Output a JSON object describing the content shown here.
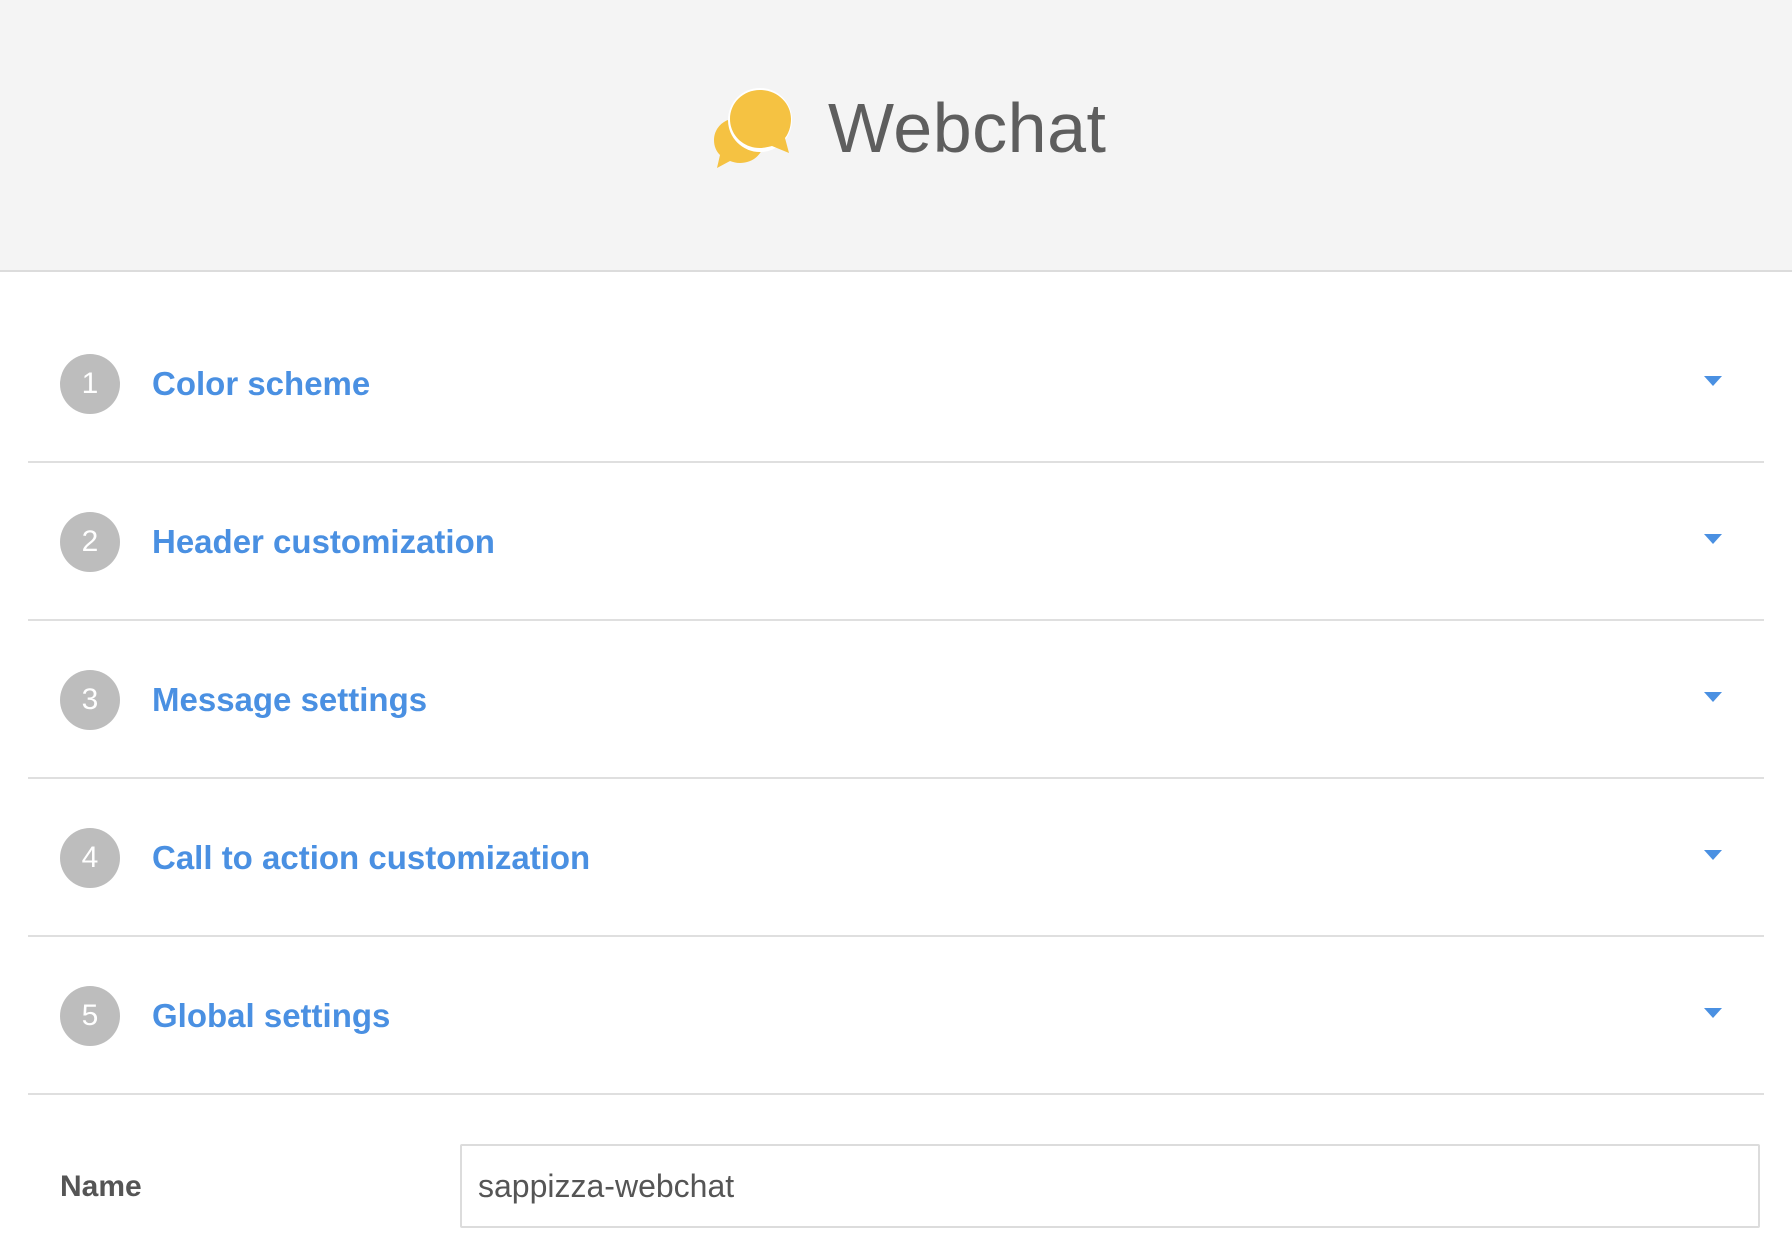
{
  "header": {
    "title": "Webchat",
    "logo_icon": "chat-bubbles-icon",
    "logo_color": "#f5c242"
  },
  "steps": [
    {
      "number": "1",
      "label": "Color scheme"
    },
    {
      "number": "2",
      "label": "Header customization"
    },
    {
      "number": "3",
      "label": "Message settings"
    },
    {
      "number": "4",
      "label": "Call to action customization"
    },
    {
      "number": "5",
      "label": "Global settings"
    }
  ],
  "form": {
    "name_label": "Name",
    "name_value": "sappizza-webchat"
  },
  "colors": {
    "accent": "#4a90e2",
    "step_badge": "#bdbdbd",
    "header_bg": "#f4f4f4"
  }
}
